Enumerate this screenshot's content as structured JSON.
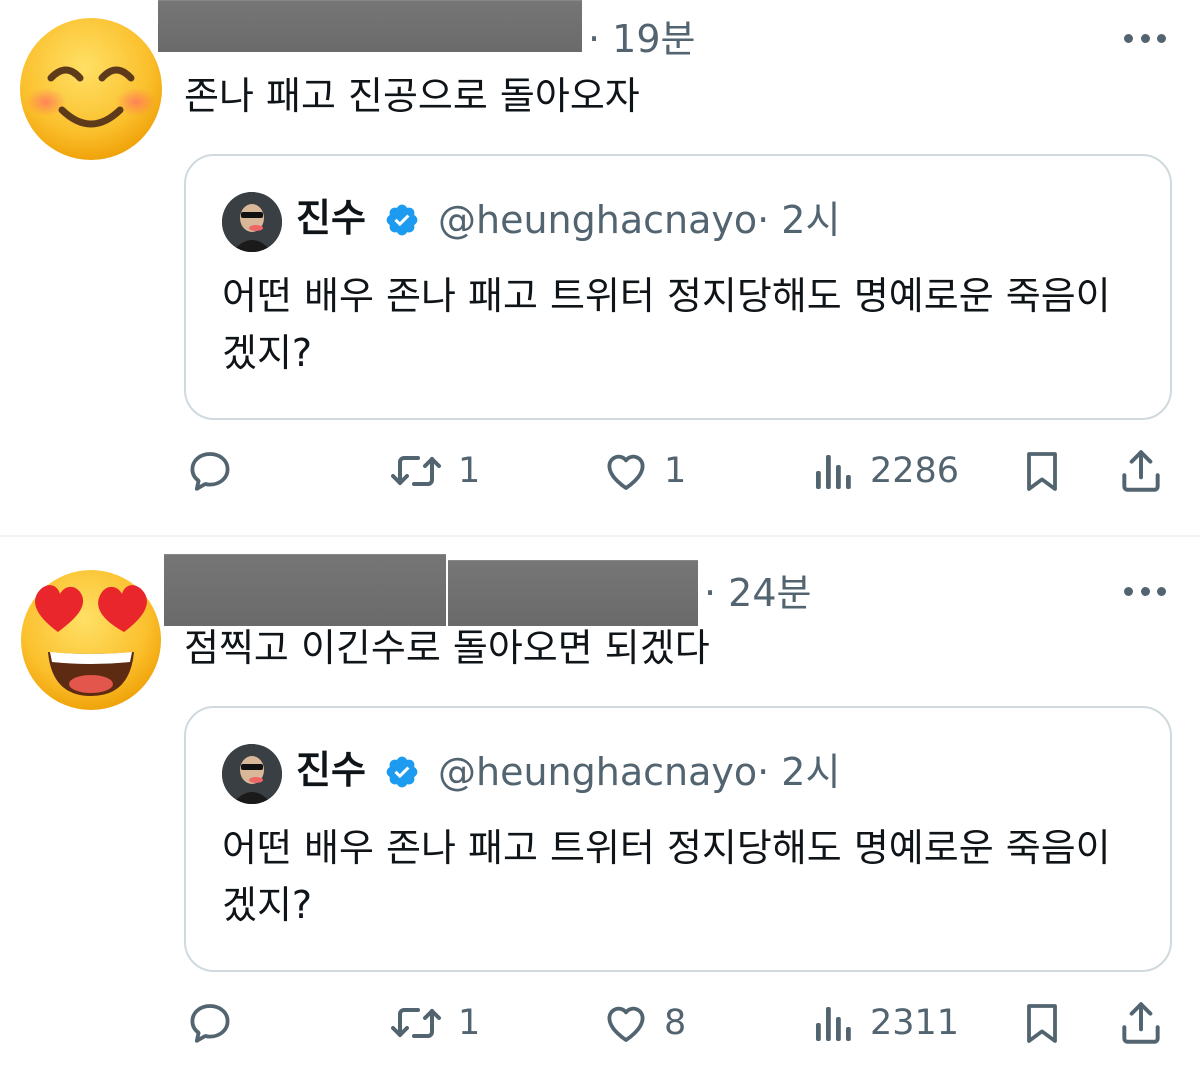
{
  "posts": [
    {
      "avatar_emoji": "smiling-face-with-smiling-eyes",
      "time": "· 19분",
      "text": "존나 패고 진공으로 돌아오자",
      "quote": {
        "name": "진수",
        "handle": "@heunghacnayo",
        "time": "· 2시",
        "text": "어떤 배우 존나 패고 트위터 정지당해도 명예로운 죽음이겠지?"
      },
      "stats": {
        "retweets": "1",
        "likes": "1",
        "views": "2286"
      }
    },
    {
      "avatar_emoji": "smiling-face-with-heart-eyes",
      "time": "· 24분",
      "text": "점찍고 이긴수로 돌아오면 되겠다",
      "quote": {
        "name": "진수",
        "handle": "@heunghacnayo",
        "time": "· 2시",
        "text": "어떤 배우 존나 패고 트위터 정지당해도 명예로운 죽음이겠지?"
      },
      "stats": {
        "retweets": "1",
        "likes": "8",
        "views": "2311"
      }
    }
  ],
  "colors": {
    "text": "#0f1419",
    "muted": "#536471",
    "border": "#cfd9de",
    "verified": "#1d9bf0",
    "redaction": "#707070"
  },
  "icons": [
    "more-icon",
    "reply-icon",
    "retweet-icon",
    "like-icon",
    "views-icon",
    "bookmark-icon",
    "share-icon",
    "verified-badge-icon"
  ]
}
